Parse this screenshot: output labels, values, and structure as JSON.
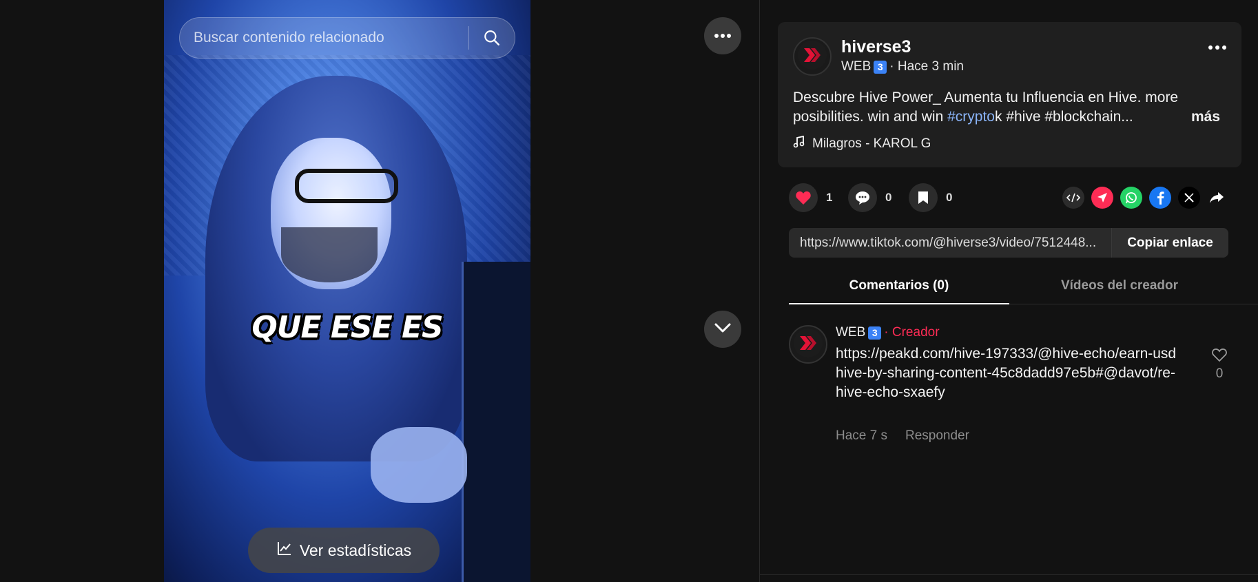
{
  "video": {
    "search_placeholder": "Buscar contenido relacionado",
    "caption": "QUE ESE ES",
    "stats_button": "Ver estadísticas"
  },
  "post": {
    "username": "hiverse3",
    "author_label": "WEB",
    "badge": "3",
    "time": "· Hace 3 min",
    "description_before": "Descubre Hive Power_ Aumenta tu Influencia en Hive. more posibilities. win and win ",
    "hashtag_link": "#crypto",
    "description_after": "k #hive #blockchain...",
    "more_label": "más",
    "music": "Milagros - KAROL G"
  },
  "actions": {
    "likes": "1",
    "comments": "0",
    "saves": "0"
  },
  "link": {
    "url": "https://www.tiktok.com/@hiverse3/video/7512448...",
    "copy_label": "Copiar enlace"
  },
  "tabs": [
    {
      "label": "Comentarios (0)"
    },
    {
      "label": "Vídeos del creador"
    }
  ],
  "comment": {
    "author": "WEB",
    "badge": "3",
    "role": "· Creador",
    "text": "https://peakd.com/hive-197333/@hive-echo/earn-usdhive-by-sharing-content-45c8dadd97e5b#@davot/re-hive-echo-sxaefy",
    "time": "Hace 7 s",
    "reply_label": "Responder",
    "likes": "0"
  },
  "colors": {
    "accent": "#fe2c55",
    "hashtag": "#8ab4f8",
    "background": "#121212"
  }
}
